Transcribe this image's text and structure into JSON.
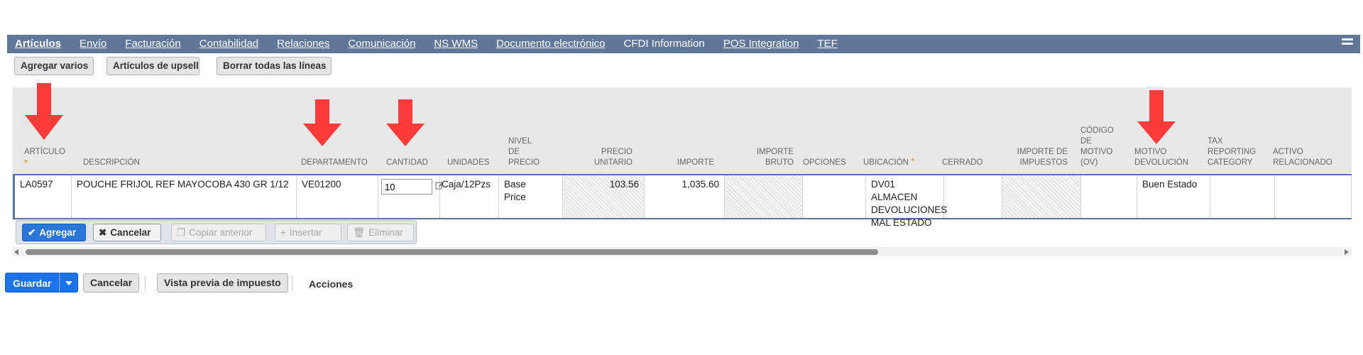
{
  "tabs": [
    {
      "label": "Artículos",
      "active": true
    },
    {
      "label": "Envío"
    },
    {
      "label": "Facturación"
    },
    {
      "label": "Contabilidad"
    },
    {
      "label": "Relaciones"
    },
    {
      "label": "Comunicación"
    },
    {
      "label": "NS WMS"
    },
    {
      "label": "Documento electrónico"
    },
    {
      "label": "CFDI Information"
    },
    {
      "label": "POS Integration"
    },
    {
      "label": "TEF"
    }
  ],
  "toolbar": {
    "add_multiple": "Agregar varios",
    "upsell": "Artículos de upsell",
    "clear_lines": "Borrar todas las líneas"
  },
  "columns": {
    "articulo": "ARTÍCULO",
    "descripcion": "DESCRIPCIÓN",
    "departamento": "DEPARTAMENTO",
    "cantidad": "CANTIDAD",
    "unidades": "UNIDADES",
    "nivel_precio": [
      "NIVEL",
      "DE",
      "PRECIO"
    ],
    "precio_unitario": [
      "PRECIO",
      "UNITARIO"
    ],
    "importe": "IMPORTE",
    "importe_bruto": [
      "IMPORTE",
      "BRUTO"
    ],
    "opciones": "OPCIONES",
    "ubicacion": "UBICACIÓN",
    "cerrado": "CERRADO",
    "importe_impuestos": [
      "IMPORTE DE",
      "IMPUESTOS"
    ],
    "codigo_motivo": [
      "CÓDIGO",
      "DE",
      "MOTIVO",
      "(OV)"
    ],
    "motivo_devolucion": [
      "MOTIVO",
      "DEVOLUCIÓN"
    ],
    "tax_reporting": [
      "TAX",
      "REPORTING",
      "CATEGORY"
    ],
    "activo_relacionado": [
      "ACTIVO",
      "RELACIONADO"
    ],
    "required_mark": "*"
  },
  "row": {
    "articulo": "LA0597",
    "descripcion": "POUCHE FRIJOL REF MAYOCOBA 430 GR 1/12",
    "departamento": "VE01200",
    "cantidad": "10",
    "unidades": "Caja/12Pzs",
    "nivel_precio": [
      "Base",
      "Price"
    ],
    "precio_unitario": "103.56",
    "importe": "1,035.60",
    "ubicacion": [
      "DV01 ALMACEN",
      "DEVOLUCIONES",
      "MAL ESTADO"
    ],
    "motivo_devolucion": "Buen Estado"
  },
  "row_actions": {
    "add": "Agregar",
    "cancel": "Cancelar",
    "copy_previous": "Copiar anterior",
    "insert": "Insertar",
    "delete": "Eliminar"
  },
  "footer": {
    "save": "Guardar",
    "cancel": "Cancelar",
    "tax_preview": "Vista previa de impuesto",
    "actions": "Acciones"
  },
  "icons": {
    "tab_menu": "hamburger-icon",
    "add": "checkmark-icon",
    "cancel": "x-icon",
    "copy": "copy-icon",
    "insert": "plus-icon",
    "delete": "trash-icon",
    "annotation": "red-down-arrow",
    "save_dropdown": "chevron-down-icon"
  },
  "colors": {
    "tab_bar": "#607799",
    "primary_button": "#1a73e8",
    "annotation_arrow": "#ff3b3b",
    "required_mark": "#d5a01e"
  }
}
